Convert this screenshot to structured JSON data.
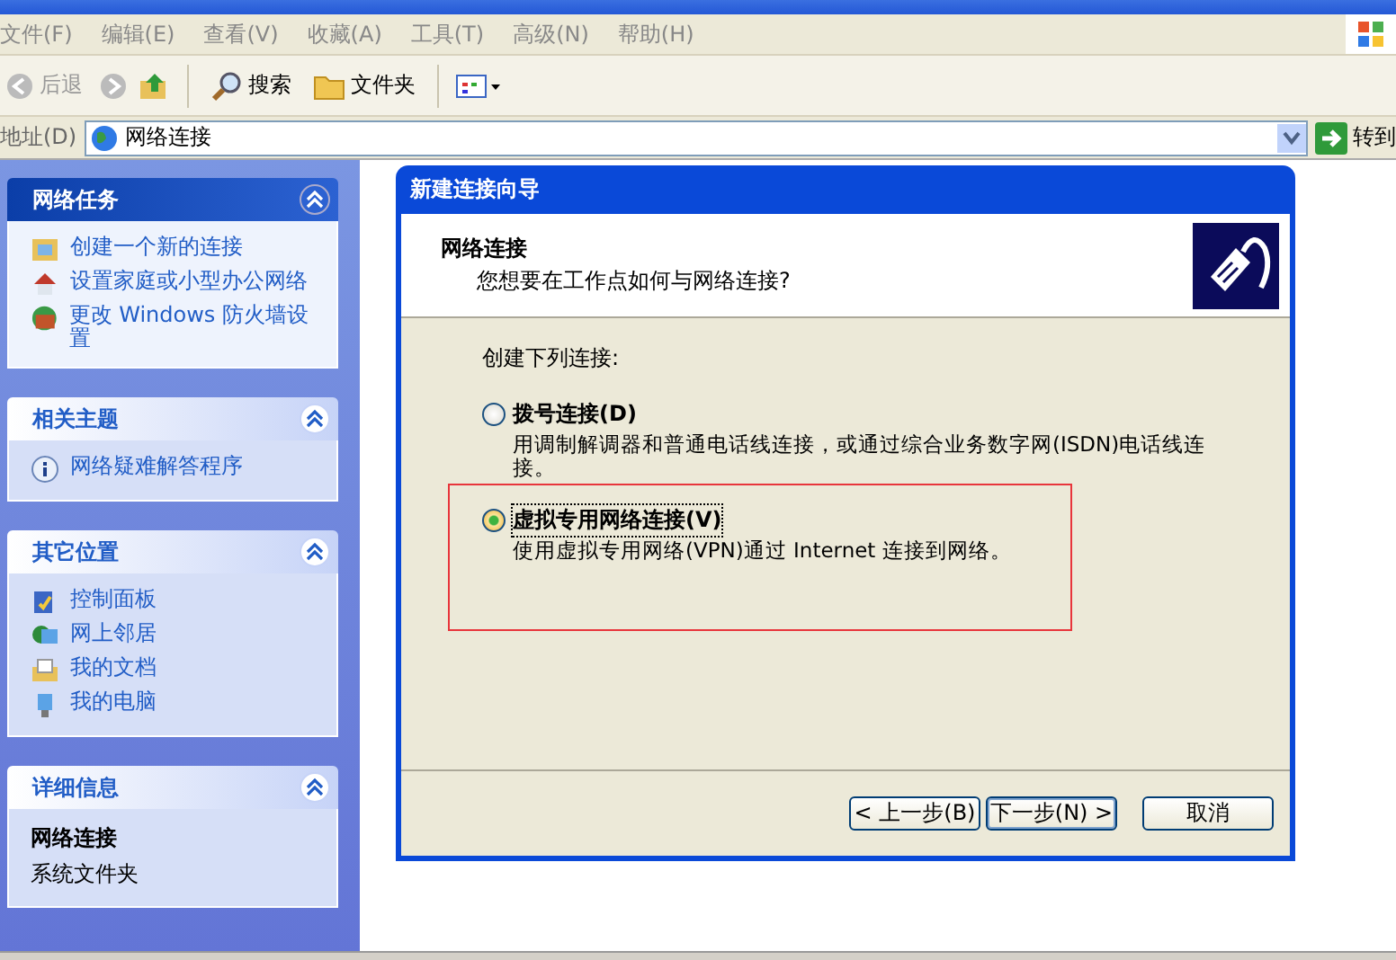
{
  "menu": [
    "文件(F)",
    "编辑(E)",
    "查看(V)",
    "收藏(A)",
    "工具(T)",
    "高级(N)",
    "帮助(H)"
  ],
  "toolbar": {
    "back": "后退",
    "search": "搜索",
    "folders": "文件夹"
  },
  "address": {
    "label": "地址(D)",
    "value": "网络连接",
    "go": "转到"
  },
  "sidebar": [
    {
      "title": "网络任务",
      "expanded": true,
      "items": [
        "创建一个新的连接",
        "设置家庭或小型办公网络",
        "更改 Windows 防火墙设置"
      ]
    },
    {
      "title": "相关主题",
      "expanded": true,
      "items": [
        "网络疑难解答程序"
      ]
    },
    {
      "title": "其它位置",
      "expanded": true,
      "items": [
        "控制面板",
        "网上邻居",
        "我的文档",
        "我的电脑"
      ]
    },
    {
      "title": "详细信息",
      "expanded": true,
      "name": "网络连接",
      "type": "系统文件夹"
    }
  ],
  "dialog": {
    "title": "新建连接向导",
    "heading": "网络连接",
    "subheading": "您想要在工作点如何与网络连接?",
    "prompt": "创建下列连接:",
    "options": [
      {
        "label": "拨号连接(D)",
        "description": "用调制解调器和普通电话线连接，或通过综合业务数字网(ISDN)电话线连接。",
        "selected": false,
        "highlighted": false
      },
      {
        "label": "虚拟专用网络连接(V)",
        "description": "使用虚拟专用网络(VPN)通过 Internet 连接到网络。",
        "selected": true,
        "highlighted": true
      }
    ],
    "buttons": [
      {
        "label": "< 上一步(B)",
        "default": false
      },
      {
        "label": "下一步(N) >",
        "default": true
      },
      {
        "label": "取消",
        "default": false
      }
    ]
  }
}
